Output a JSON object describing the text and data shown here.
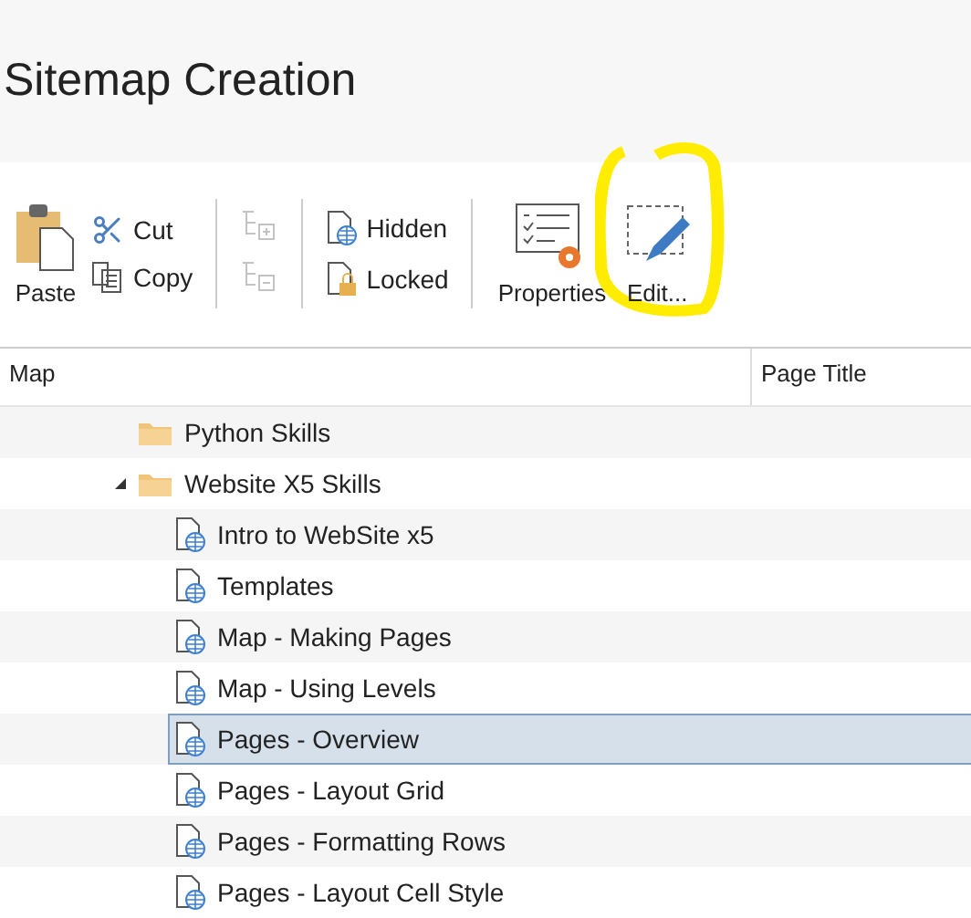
{
  "title": "Sitemap Creation",
  "toolbar": {
    "paste": "Paste",
    "cut": "Cut",
    "copy": "Copy",
    "level_buttons": [
      {
        "kind": "add",
        "disabled": true
      },
      {
        "kind": "remove",
        "disabled": true
      }
    ],
    "hidden": "Hidden",
    "locked": "Locked",
    "properties": "Properties",
    "edit": "Edit..."
  },
  "columns": [
    "Map",
    "Page Title"
  ],
  "tree": [
    {
      "kind": "folder",
      "label": "Python Skills",
      "selected": false
    },
    {
      "kind": "folder",
      "label": "Website X5 Skills",
      "expanded": true,
      "selected": false,
      "children": [
        {
          "kind": "page",
          "label": "Intro to WebSite x5",
          "selected": false
        },
        {
          "kind": "page",
          "label": "Templates",
          "selected": false
        },
        {
          "kind": "page",
          "label": "Map - Making Pages",
          "selected": false
        },
        {
          "kind": "page",
          "label": "Map - Using Levels",
          "selected": false
        },
        {
          "kind": "page",
          "label": "Pages - Overview",
          "selected": true
        },
        {
          "kind": "page",
          "label": "Pages - Layout Grid",
          "selected": false
        },
        {
          "kind": "page",
          "label": "Pages - Formatting Rows",
          "selected": false
        },
        {
          "kind": "page",
          "label": "Pages - Layout Cell Style",
          "selected": false
        }
      ]
    }
  ]
}
